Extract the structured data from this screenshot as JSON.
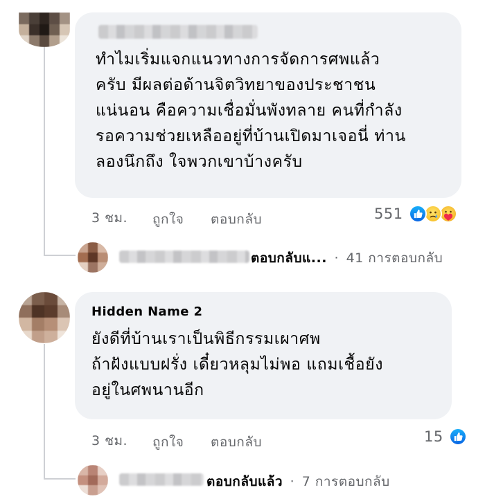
{
  "comments": [
    {
      "author": "",
      "text": "ทำไมเริ่มแจกแนวทางการจัดการศพแล้ว\nครับ มีผลต่อด้านจิตวิทยาของประชาชน\nแน่นอน คือความเชื่อมั่นพังทลาย คนที่กำลัง\nรอความช่วยเหลืออยู่ที่บ้านเปิดมาเจอนี่ ท่าน\nลองนึกถึง ใจพวกเขาบ้างครับ",
      "time": "3 ชม.",
      "like_label": "ถูกใจ",
      "reply_label": "ตอบกลับ",
      "reaction_count": "551",
      "reactions": [
        "like-icon",
        "sad-icon",
        "care-icon"
      ],
      "reply_preview": {
        "label": "ตอบกลับแ...",
        "separator": "·",
        "count_text": "41 การตอบกลับ"
      }
    },
    {
      "author": "Hidden Name 2",
      "text": "ยังดีที่บ้านเราเป็นพิธีกรรมเผาศพ\nถ้าฝังแบบฝรั่ง เดี๋ยวหลุมไม่พอ แถมเชื้อยัง\nอยู่ในศพนานอีก",
      "time": "3 ชม.",
      "like_label": "ถูกใจ",
      "reply_label": "ตอบกลับ",
      "reaction_count": "15",
      "reactions": [
        "like-icon"
      ],
      "reply_preview": {
        "label": "ตอบกลับแล้ว",
        "separator": "·",
        "count_text": "7 การตอบกลับ"
      }
    }
  ],
  "colors": {
    "bubble": "#f0f2f5",
    "meta_text": "#65676b",
    "like_blue": "#1877f2",
    "thread_line": "#ced0d4"
  }
}
